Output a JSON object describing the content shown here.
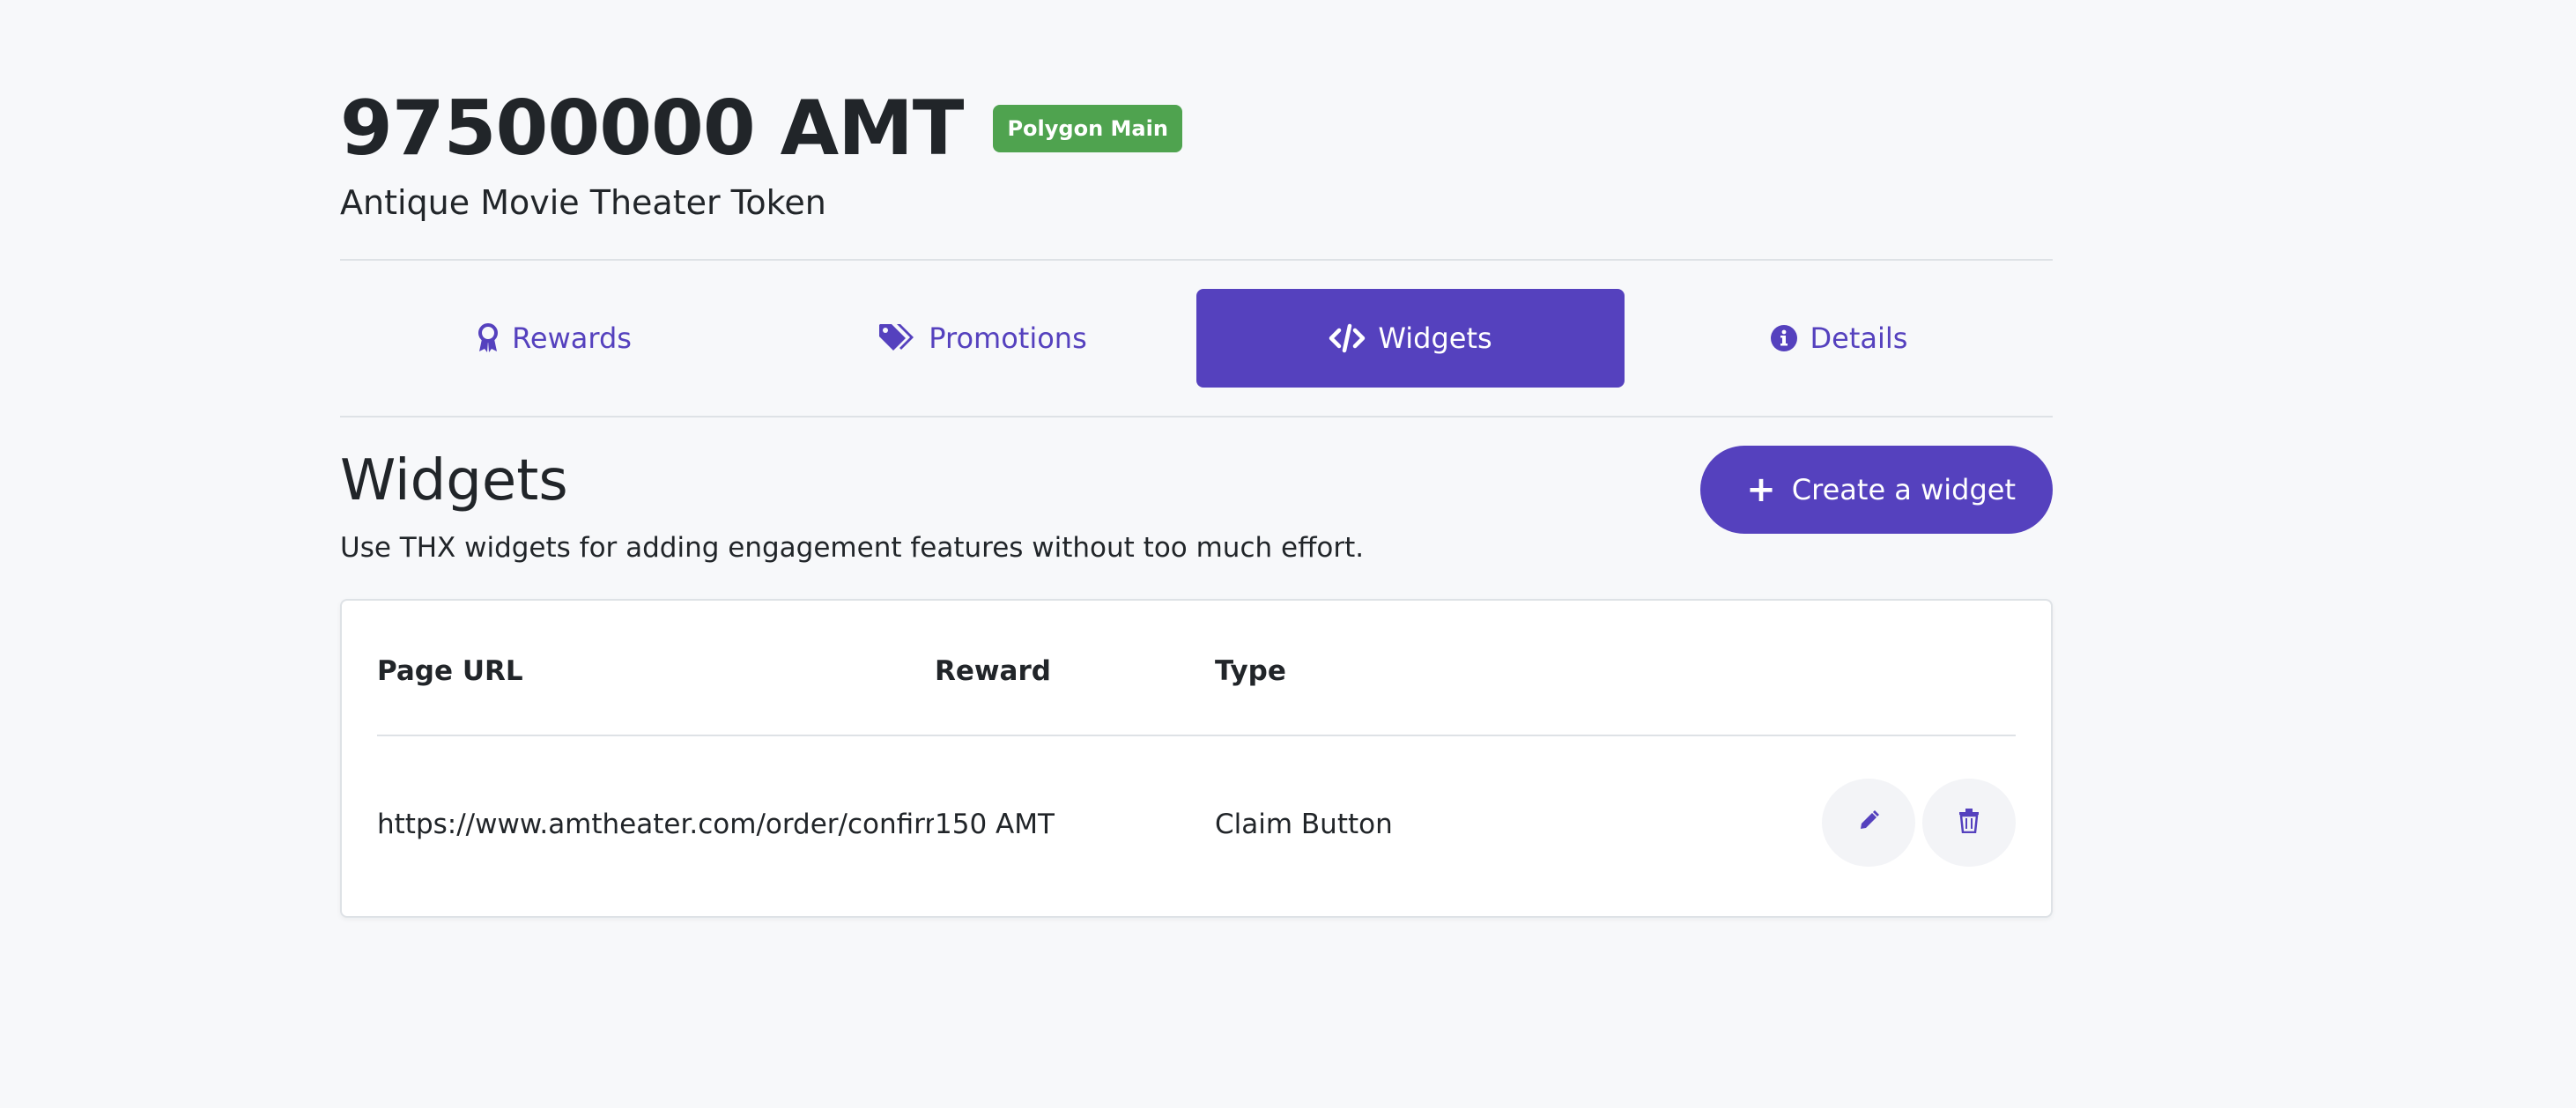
{
  "token": {
    "amount": "97500000 AMT",
    "network": "Polygon Main",
    "name": "Antique Movie Theater Token"
  },
  "tabs": [
    {
      "label": "Rewards",
      "icon": "award-icon"
    },
    {
      "label": "Promotions",
      "icon": "tags-icon"
    },
    {
      "label": "Widgets",
      "icon": "code-icon",
      "active": true
    },
    {
      "label": "Details",
      "icon": "info-circle-icon"
    }
  ],
  "section": {
    "title": "Widgets",
    "description": "Use THX widgets for adding engagement features without too much effort.",
    "create_button": "Create a widget"
  },
  "table": {
    "headers": [
      "Page URL",
      "Reward",
      "Type"
    ],
    "rows": [
      {
        "page_url": "https://www.amtheater.com/order/confirm",
        "reward": "150 AMT",
        "type": "Claim Button"
      }
    ]
  },
  "colors": {
    "accent": "#5541be",
    "badge": "#4fa34f",
    "background": "#f7f8fa"
  }
}
